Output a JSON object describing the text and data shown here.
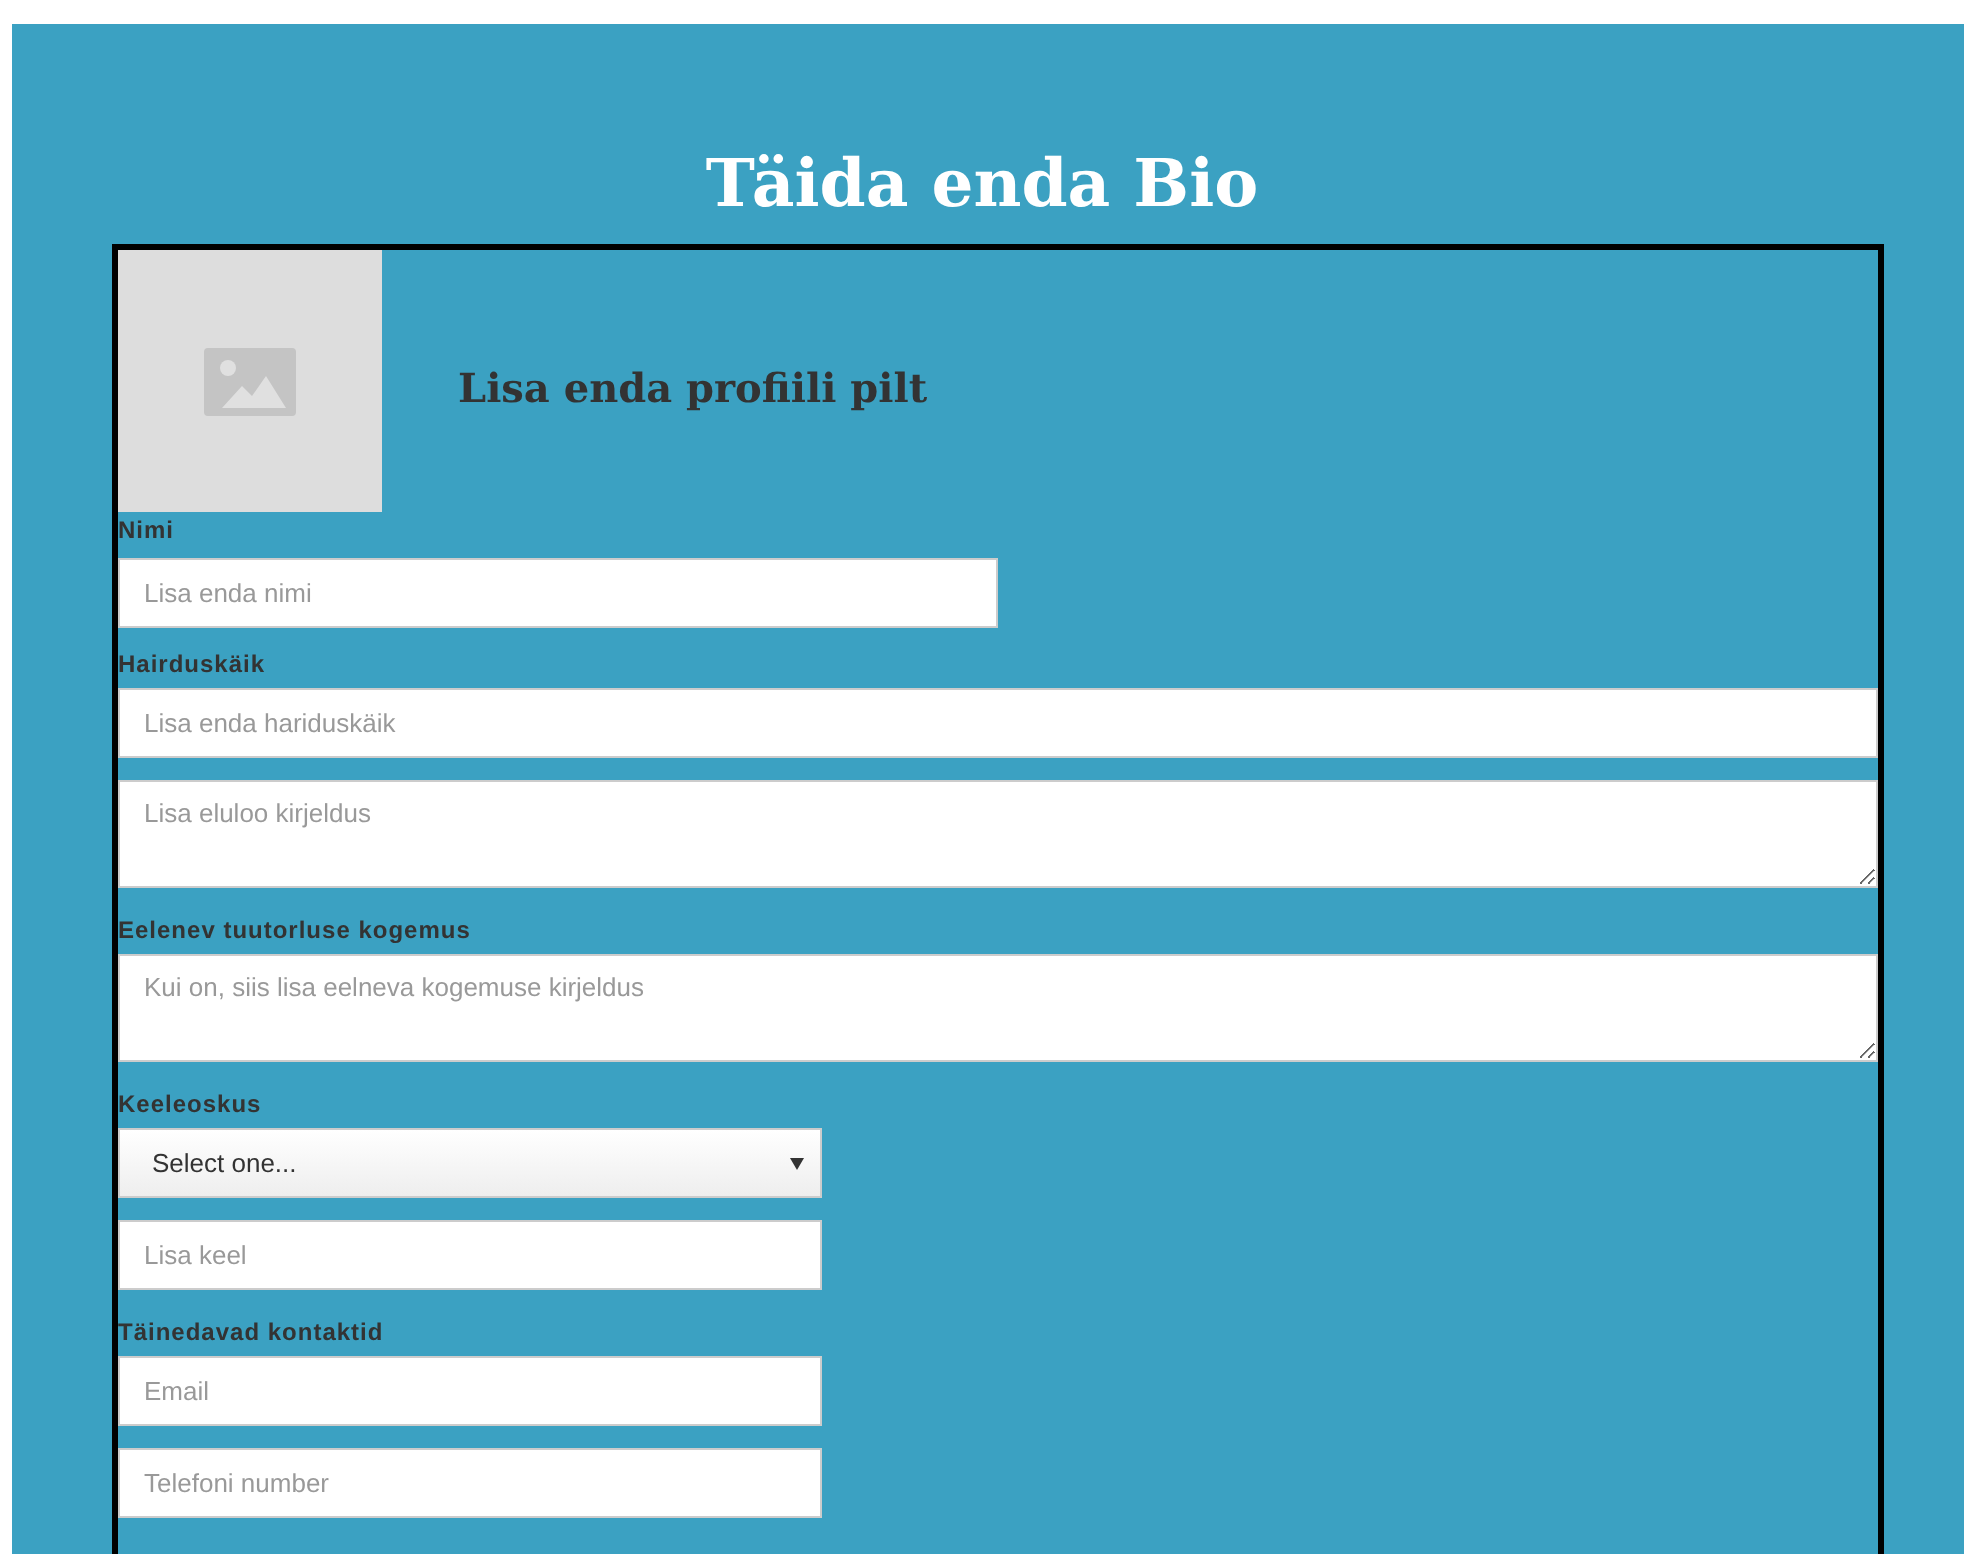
{
  "title": "Täida enda Bio",
  "profile": {
    "heading": "Lisa enda profiili pilt"
  },
  "sections": [
    {
      "label": "Nimi",
      "fields": [
        {
          "kind": "short-input",
          "placeholder": "Lisa enda nimi"
        }
      ]
    },
    {
      "label": "Hairduskäik",
      "fields": [
        {
          "kind": "long-input",
          "placeholder": "Lisa enda hariduskäik"
        },
        {
          "kind": "textarea",
          "placeholder": "Lisa eluloo kirjeldus"
        }
      ]
    },
    {
      "label": "Eelenev tuutorluse kogemus",
      "fields": [
        {
          "kind": "textarea",
          "placeholder": "Kui on, siis lisa eelneva kogemuse kirjeldus"
        }
      ]
    },
    {
      "label": "Keeleoskus",
      "fields": [
        {
          "kind": "select",
          "value": "Select one..."
        },
        {
          "kind": "narrow-input",
          "placeholder": "Lisa keel"
        }
      ]
    },
    {
      "label": "Täinedavad kontaktid",
      "fields": [
        {
          "kind": "narrow-input",
          "placeholder": "Email"
        },
        {
          "kind": "narrow-input",
          "placeholder": "Telefoni number"
        }
      ]
    }
  ]
}
